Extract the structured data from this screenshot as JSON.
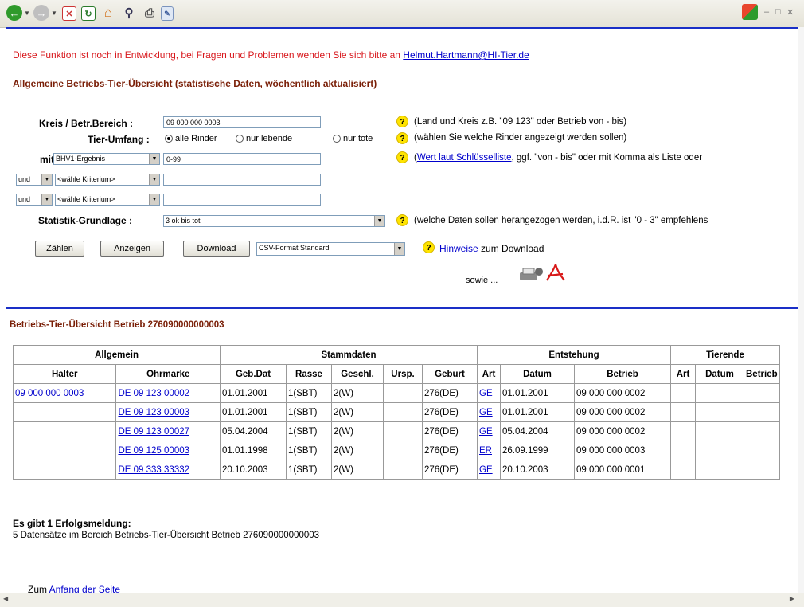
{
  "notice": {
    "prefix": "Diese Funktion ist noch in Entwicklung, bei Fragen und Problemen wenden Sie sich bitte an",
    "email": "Helmut.Hartmann@HI-Tier.de"
  },
  "form": {
    "heading": "Allgemeine Betriebs-Tier-Übersicht (statistische Daten, wöchentlich aktualisiert)",
    "kreis_label": "Kreis / Betr.Bereich :",
    "kreis_value": "09 000 000 0003",
    "kreis_hint": "(Land und Kreis z.B. \"09 123\" oder Betrieb von - bis)",
    "tier_label": "Tier-Umfang :",
    "tier_options": [
      "alle Rinder",
      "nur lebende",
      "nur tote"
    ],
    "tier_hint": "(wählen Sie welche Rinder angezeigt werden sollen)",
    "mit_label": "mit",
    "mit_select": "BHV1-Ergebnis",
    "mit_value": "0-99",
    "mit_hint_link": "Wert laut Schlüsselliste",
    "mit_hint_rest": ", ggf. \"von - bis\" oder mit Komma als Liste oder",
    "und_label": "und",
    "criterion_placeholder": "<wähle Kriterium>",
    "stat_label": "Statistik-Grundlage :",
    "stat_value": "3 ok bis tot",
    "stat_hint": "(welche Daten sollen herangezogen werden, i.d.R. ist \"0 - 3\" empfehlens",
    "btn_count": "Zählen",
    "btn_show": "Anzeigen",
    "btn_download": "Download",
    "format_value": "CSV-Format Standard",
    "hints_link": "Hinweise",
    "hints_rest": "zum Download",
    "sowie": "sowie ..."
  },
  "result": {
    "heading": "Betriebs-Tier-Übersicht Betrieb 276090000000003",
    "groups": [
      "Allgemein",
      "Stammdaten",
      "Entstehung",
      "Tierende"
    ],
    "columns": [
      "Halter",
      "Ohrmarke",
      "Geb.Dat",
      "Rasse",
      "Geschl.",
      "Ursp.",
      "Geburt",
      "Art",
      "Datum",
      "Betrieb",
      "Art",
      "Datum",
      "Betrieb"
    ],
    "rows": [
      {
        "halter": "09 000 000 0003",
        "ohrmarke": "DE 09 123 00002",
        "gebdat": "01.01.2001",
        "rasse": "1(SBT)",
        "geschl": "2(W)",
        "ursp": "",
        "geburt": "276(DE)",
        "art": "GE",
        "datum": "01.01.2001",
        "betrieb": "09 000 000 0002"
      },
      {
        "halter": "",
        "ohrmarke": "DE 09 123 00003",
        "gebdat": "01.01.2001",
        "rasse": "1(SBT)",
        "geschl": "2(W)",
        "ursp": "",
        "geburt": "276(DE)",
        "art": "GE",
        "datum": "01.01.2001",
        "betrieb": "09 000 000 0002"
      },
      {
        "halter": "",
        "ohrmarke": "DE 09 123 00027",
        "gebdat": "05.04.2004",
        "rasse": "1(SBT)",
        "geschl": "2(W)",
        "ursp": "",
        "geburt": "276(DE)",
        "art": "GE",
        "datum": "05.04.2004",
        "betrieb": "09 000 000 0002"
      },
      {
        "halter": "",
        "ohrmarke": "DE 09 125 00003",
        "gebdat": "01.01.1998",
        "rasse": "1(SBT)",
        "geschl": "2(W)",
        "ursp": "",
        "geburt": "276(DE)",
        "art": "ER",
        "datum": "26.09.1999",
        "betrieb": "09 000 000 0003"
      },
      {
        "halter": "",
        "ohrmarke": "DE 09 333 33332",
        "gebdat": "20.10.2003",
        "rasse": "1(SBT)",
        "geschl": "2(W)",
        "ursp": "",
        "geburt": "276(DE)",
        "art": "GE",
        "datum": "20.10.2003",
        "betrieb": "09 000 000 0001"
      }
    ]
  },
  "message": {
    "title": "Es gibt 1 Erfolgsmeldung:",
    "text": "5 Datensätze im Bereich Betriebs-Tier-Übersicht Betrieb 276090000000003"
  },
  "footer": {
    "prefix": "Zum",
    "link": "Anfang der Seite"
  },
  "colors": {
    "accent_blue": "#1a2fc7",
    "notice_red": "#d8181d",
    "heading_maroon": "#7a1f07"
  }
}
